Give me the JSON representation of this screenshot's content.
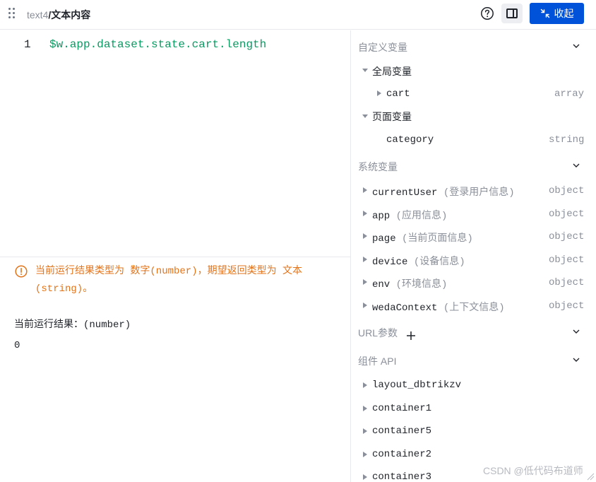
{
  "header": {
    "component": "text4",
    "separator": "/",
    "title": "文本内容",
    "collapse_label": "收起",
    "icons": [
      "drag-handle-icon",
      "help-icon",
      "panel-toggle-icon",
      "collapse-icon"
    ]
  },
  "editor": {
    "line_number": "1",
    "code": "$w.app.dataset.state.cart.length"
  },
  "result": {
    "warning": "当前运行结果类型为 数字(number)，期望返回类型为 文本(string)。",
    "label": "当前运行结果：(number)",
    "value": "0"
  },
  "sidebar": {
    "custom_vars": {
      "title": "自定义变量",
      "global": {
        "label": "全局变量",
        "items": [
          {
            "name": "cart",
            "type": "array"
          }
        ]
      },
      "page": {
        "label": "页面变量",
        "items": [
          {
            "name": "category",
            "type": "string"
          }
        ]
      }
    },
    "system_vars": {
      "title": "系统变量",
      "items": [
        {
          "name": "currentUser",
          "desc": "(登录用户信息)",
          "type": "object"
        },
        {
          "name": "app",
          "desc": "(应用信息)",
          "type": "object"
        },
        {
          "name": "page",
          "desc": "(当前页面信息)",
          "type": "object"
        },
        {
          "name": "device",
          "desc": "(设备信息)",
          "type": "object"
        },
        {
          "name": "env",
          "desc": "(环境信息)",
          "type": "object"
        },
        {
          "name": "wedaContext",
          "desc": "(上下文信息)",
          "type": "object"
        }
      ]
    },
    "url_params": {
      "title": "URL参数"
    },
    "component_api": {
      "title": "组件 API",
      "items": [
        "layout_dbtrikzv",
        "container1",
        "container5",
        "container2",
        "container3"
      ]
    }
  },
  "watermark": "CSDN @低代码布道师",
  "colors": {
    "primary": "#0052d9",
    "code": "#0a9a62",
    "warning": "#e37318",
    "muted": "#8a8f99"
  }
}
